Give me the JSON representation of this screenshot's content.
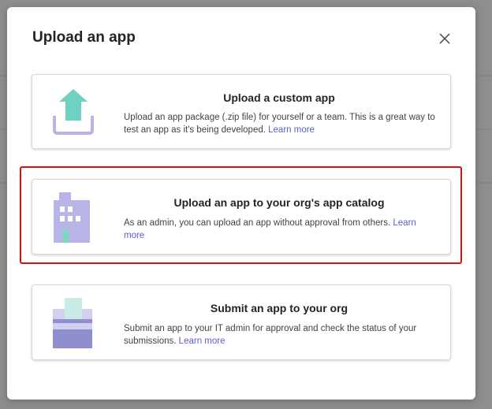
{
  "dialog": {
    "title": "Upload an app",
    "close_icon": "close-icon"
  },
  "options": [
    {
      "title": "Upload a custom app",
      "description": "Upload an app package (.zip file) for yourself or a team. This is a great way to test an app as it's being developed.",
      "link": "Learn more",
      "icon": "upload-icon"
    },
    {
      "title": "Upload an app to your org's app catalog",
      "description": "As an admin, you can upload an app without approval from others.",
      "link": "Learn more",
      "icon": "building-icon"
    },
    {
      "title": "Submit an app to your org",
      "description": "Submit an app to your IT admin for approval and check the status of your submissions.",
      "link": "Learn more",
      "icon": "submit-icon"
    }
  ],
  "colors": {
    "link": "#5b5fc7",
    "highlight": "#e00d0d",
    "upload_arrow": "#6fd1c1",
    "icon_purple": "#b8b5e6"
  }
}
